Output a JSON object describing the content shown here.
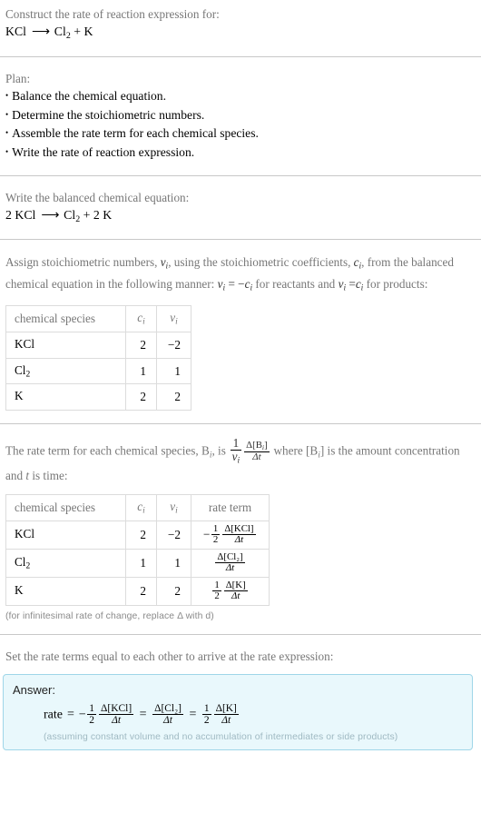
{
  "header": {
    "prompt": "Construct the rate of reaction expression for:",
    "reaction": {
      "reactant": "KCl",
      "arrow": "⟶",
      "product_1": "Cl",
      "product_1_sub": "2",
      "plus": "+",
      "product_2": "K"
    }
  },
  "plan": {
    "title": "Plan:",
    "steps": [
      "Balance the chemical equation.",
      "Determine the stoichiometric numbers.",
      "Assemble the rate term for each chemical species.",
      "Write the rate of reaction expression."
    ]
  },
  "balanced": {
    "prompt": "Write the balanced chemical equation:",
    "equation": {
      "reactant_coeff": "2",
      "reactant": "KCl",
      "arrow": "⟶",
      "product_1": "Cl",
      "product_1_sub": "2",
      "plus": "+",
      "product_2_coeff": "2",
      "product_2": "K"
    }
  },
  "stoich": {
    "text_part_1": "Assign stoichiometric numbers, ",
    "nu_i": "ν",
    "text_part_2": ", using the stoichiometric coefficients, ",
    "c_i": "c",
    "text_part_3": ", from the balanced chemical equation in the following manner: ",
    "rule_reactants": "= −",
    "text_part_4": " for reactants and ",
    "rule_products": "=",
    "text_part_5": " for products:",
    "table": {
      "headers": [
        "chemical species",
        "c",
        "ν"
      ],
      "header_sub": "i",
      "rows": [
        {
          "species": "KCl",
          "species_sub": "",
          "c": "2",
          "v": "−2"
        },
        {
          "species": "Cl",
          "species_sub": "2",
          "c": "1",
          "v": "1"
        },
        {
          "species": "K",
          "species_sub": "",
          "c": "2",
          "v": "2"
        }
      ]
    }
  },
  "rate_term": {
    "text_part_1": "The rate term for each chemical species, B",
    "sub_i": "i",
    "text_part_2": ", is ",
    "fraction_num": "1",
    "fraction_den": "ν",
    "delta_num": "Δ[B",
    "delta_num_close": "]",
    "delta_den": "Δt",
    "text_part_3": " where [B",
    "text_part_4": "] is the amount concentration and ",
    "t_italic": "t",
    "text_part_5": " is time:",
    "table": {
      "headers": [
        "chemical species",
        "c",
        "ν",
        "rate term"
      ],
      "header_sub": "i",
      "rows": [
        {
          "species": "KCl",
          "species_sub": "",
          "c": "2",
          "v": "−2",
          "rate_sign": "−",
          "rate_coeff_num": "1",
          "rate_coeff_den": "2",
          "rate_delta_num": "Δ[KCl]",
          "rate_delta_den": "Δt"
        },
        {
          "species": "Cl",
          "species_sub": "2",
          "c": "1",
          "v": "1",
          "rate_sign": "",
          "rate_coeff_num": "",
          "rate_coeff_den": "",
          "rate_delta_num": "Δ[Cl₂]",
          "rate_delta_den": "Δt"
        },
        {
          "species": "K",
          "species_sub": "",
          "c": "2",
          "v": "2",
          "rate_sign": "",
          "rate_coeff_num": "1",
          "rate_coeff_den": "2",
          "rate_delta_num": "Δ[K]",
          "rate_delta_den": "Δt"
        }
      ]
    },
    "footnote": "(for infinitesimal rate of change, replace Δ with d)"
  },
  "final": {
    "prompt": "Set the rate terms equal to each other to arrive at the rate expression:",
    "answer_label": "Answer:",
    "rate_word": "rate",
    "equals": "=",
    "term_1": {
      "sign": "−",
      "coeff_num": "1",
      "coeff_den": "2",
      "delta_num": "Δ[KCl]",
      "delta_den": "Δt"
    },
    "term_2": {
      "sign": "",
      "coeff_num": "",
      "coeff_den": "",
      "delta_num": "Δ[Cl₂]",
      "delta_den": "Δt"
    },
    "term_3": {
      "sign": "",
      "coeff_num": "1",
      "coeff_den": "2",
      "delta_num": "Δ[K]",
      "delta_den": "Δt"
    },
    "note": "(assuming constant volume and no accumulation of intermediates or side products)"
  },
  "colors": {
    "prompt_text": "#777777",
    "body_text": "#000000",
    "divider": "#c8c8c8",
    "table_border": "#dcdcdc",
    "answer_bg": "#e9f8fc",
    "answer_border": "#9fd6e8",
    "footnote_text": "#8a8a8a"
  }
}
